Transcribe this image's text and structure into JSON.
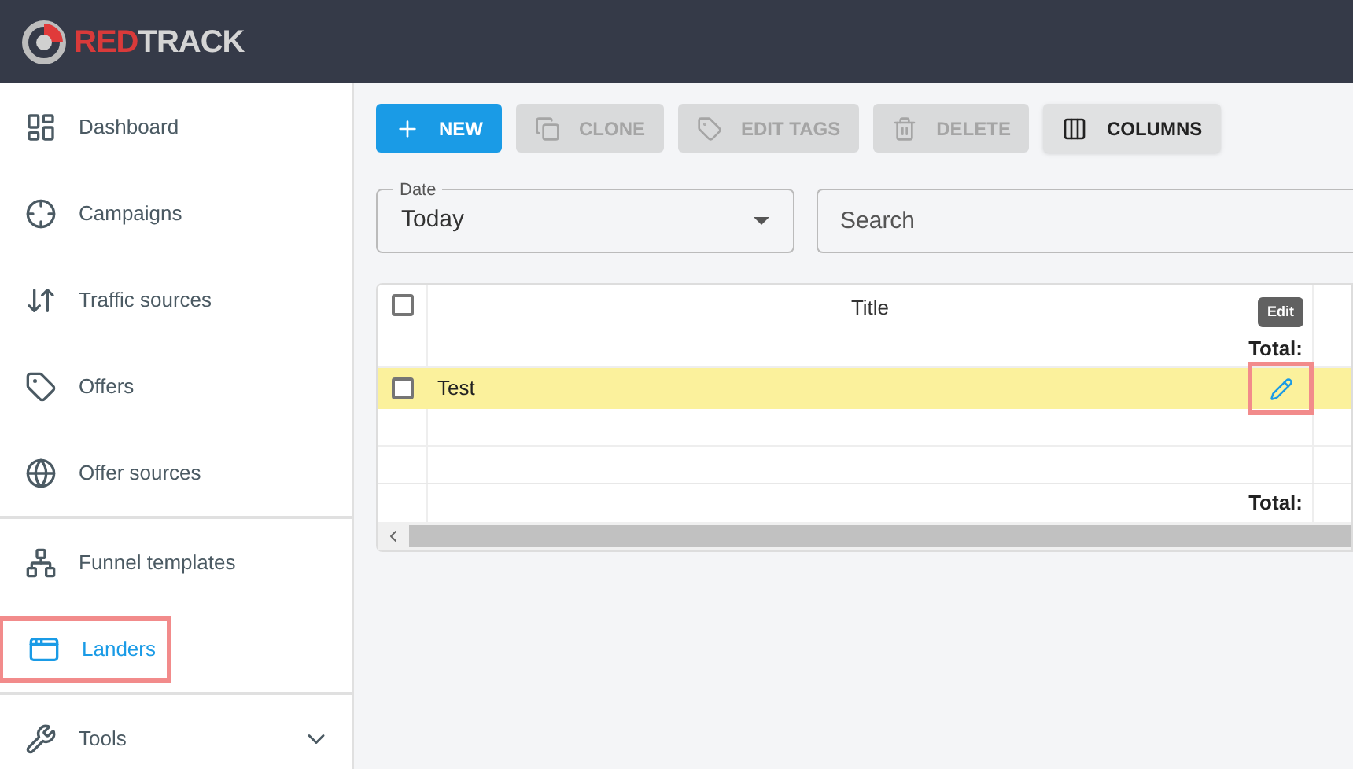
{
  "logo": {
    "part1": "RED",
    "part2": "TRACK"
  },
  "sidebar": {
    "sections": [
      {
        "items": [
          {
            "label": "Dashboard",
            "selected": false,
            "highlighted": false,
            "kind": "link"
          },
          {
            "label": "Campaigns",
            "selected": false,
            "highlighted": false,
            "kind": "link"
          },
          {
            "label": "Traffic sources",
            "selected": false,
            "highlighted": false,
            "kind": "link"
          },
          {
            "label": "Offers",
            "selected": false,
            "highlighted": false,
            "kind": "link"
          },
          {
            "label": "Offer sources",
            "selected": false,
            "highlighted": false,
            "kind": "link"
          }
        ]
      },
      {
        "items": [
          {
            "label": "Funnel templates",
            "selected": false,
            "highlighted": false,
            "kind": "link"
          },
          {
            "label": "Landers",
            "selected": true,
            "highlighted": true,
            "kind": "link"
          }
        ]
      },
      {
        "items": [
          {
            "label": "Tools",
            "selected": false,
            "highlighted": false,
            "kind": "expandable"
          }
        ]
      }
    ]
  },
  "toolbar": [
    {
      "label": "NEW",
      "disabled": false,
      "kind": "primary"
    },
    {
      "label": "CLONE",
      "disabled": true,
      "kind": "secondary"
    },
    {
      "label": "EDIT TAGS",
      "disabled": true,
      "kind": "secondary"
    },
    {
      "label": "DELETE",
      "disabled": true,
      "kind": "secondary"
    },
    {
      "label": "COLUMNS",
      "disabled": false,
      "kind": "secondary"
    }
  ],
  "date_field": {
    "label": "Date",
    "value": "Today"
  },
  "search": {
    "placeholder": "Search"
  },
  "table": {
    "columns": [
      {
        "label": "Title",
        "total": "Total:"
      }
    ],
    "rows": [
      {
        "title": "Test",
        "checked": false,
        "highlighted": true,
        "edit_highlighted": true
      }
    ],
    "tooltip": "Edit",
    "footer_total": "Total:",
    "header_checked": false
  }
}
